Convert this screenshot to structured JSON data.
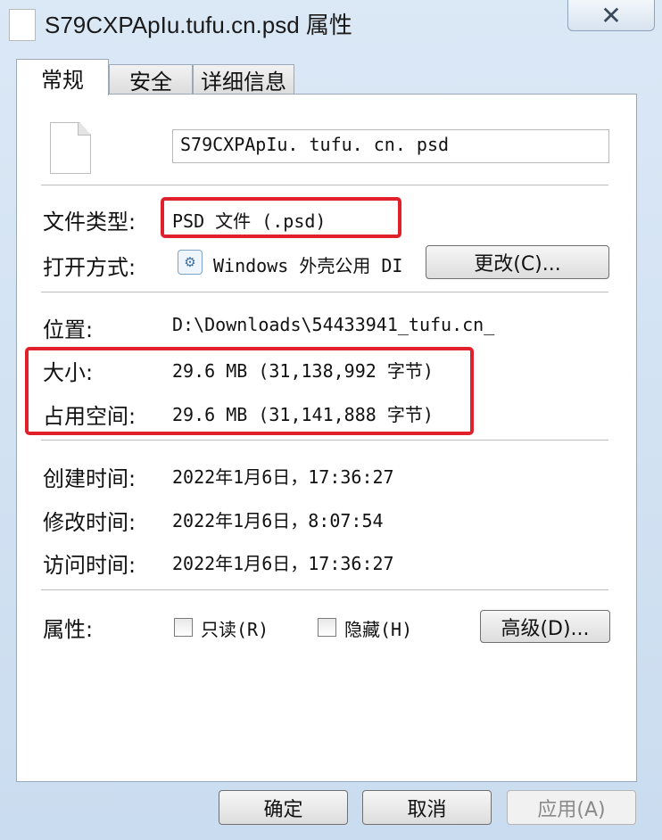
{
  "window": {
    "title": "S79CXPApIu.tufu.cn.psd 属性",
    "close_glyph": "✕"
  },
  "tabs": [
    {
      "label": "常规"
    },
    {
      "label": "安全"
    },
    {
      "label": "详细信息"
    }
  ],
  "file": {
    "name": "S79CXPApIu. tufu. cn. psd"
  },
  "props": {
    "type_label": "文件类型:",
    "type_value": "PSD 文件 (.psd)",
    "open_label": "打开方式:",
    "open_value": "Windows 外壳公用 DI",
    "change_button": "更改(C)...",
    "location_label": "位置:",
    "location_value": "D:\\Downloads\\54433941_tufu.cn_",
    "size_label": "大小:",
    "size_value": "29.6 MB (31,138,992 字节)",
    "disk_label": "占用空间:",
    "disk_value": "29.6 MB (31,141,888 字节)",
    "created_label": "创建时间:",
    "created_value": "2022年1月6日，17:36:27",
    "modified_label": "修改时间:",
    "modified_value": "2022年1月6日，8:07:54",
    "accessed_label": "访问时间:",
    "accessed_value": "2022年1月6日，17:36:27",
    "attr_label": "属性:",
    "readonly_label": "只读(R)",
    "hidden_label": "隐藏(H)",
    "advanced_button": "高级(D)..."
  },
  "footer": {
    "ok": "确定",
    "cancel": "取消",
    "apply": "应用(A)"
  },
  "colors": {
    "highlight": "#e0202a",
    "title_bar": "#cfe0f1"
  }
}
